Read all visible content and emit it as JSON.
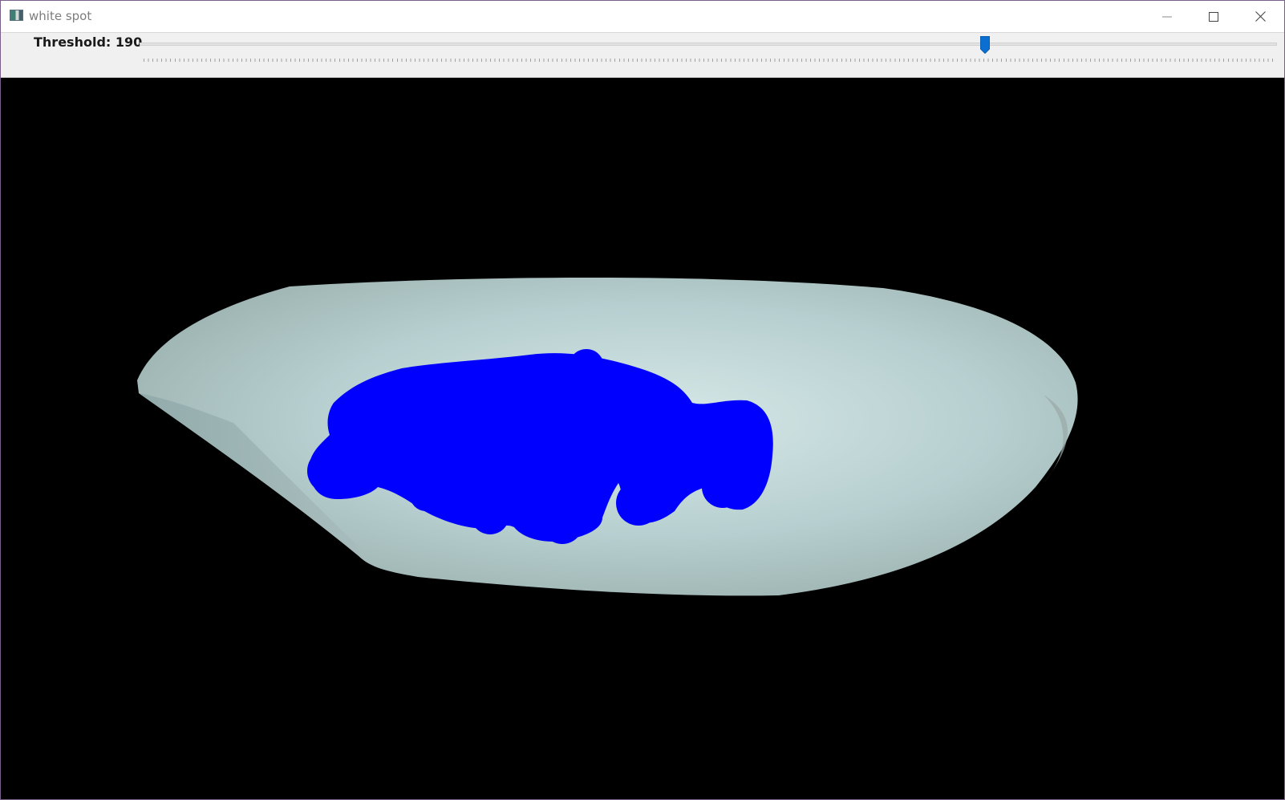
{
  "window": {
    "title": "white spot",
    "icon": "app-window-icon",
    "controls": [
      "minimize-icon",
      "maximize-icon",
      "close-icon"
    ]
  },
  "trackbar": {
    "label": "Threshold: 190",
    "name": "Threshold",
    "value": 190,
    "min": 0,
    "max": 255,
    "accent_color": "#0a6fd0"
  },
  "image": {
    "background_color": "#000000",
    "object_color": "#c3d8d8",
    "highlight_color": "#0000ff"
  }
}
